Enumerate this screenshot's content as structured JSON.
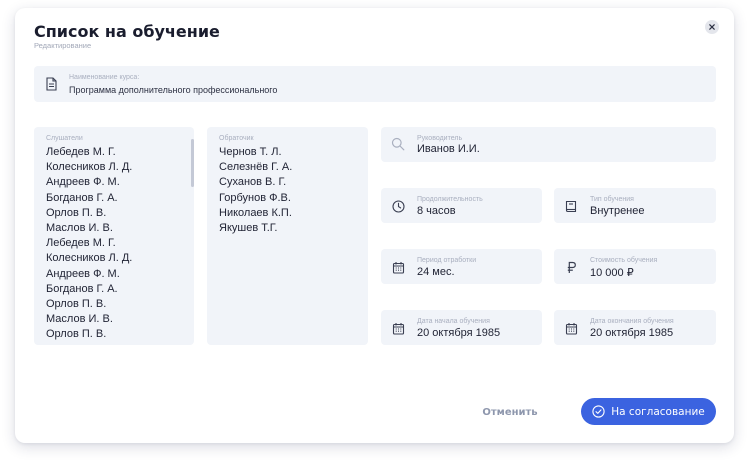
{
  "dialog": {
    "title": "Список на обучение",
    "subtitle": "Редактирование"
  },
  "course": {
    "label": "Наименование курса:",
    "value": "Программа дополнительного профессионального"
  },
  "listeners": {
    "label": "Слушатели",
    "items": [
      "Лебедев М. Г.",
      "Колесников Л. Д.",
      "Андреев Ф. М.",
      "Богданов Г. А.",
      "Орлов П. В.",
      "Маслов И. В.",
      "Лебедев М. Г.",
      "Колесников Л. Д.",
      "Андреев Ф. М.",
      "Богданов Г. А.",
      "Орлов П. В.",
      "Маслов И. В.",
      "Орлов П. В."
    ]
  },
  "trainers": {
    "label": "Обраточик",
    "items": [
      "Чернов Т. Л.",
      "Селезнёв Г. А.",
      "Суханов В. Г.",
      "Горбунов Ф.В.",
      "Николаев К.П.",
      "Якушев Т.Г."
    ]
  },
  "leader": {
    "label": "Руководитель",
    "value": "Иванов И.И."
  },
  "duration": {
    "label": "Продолжительность",
    "value": "8 часов"
  },
  "training_type": {
    "label": "Тип обучения",
    "value": "Внутренее"
  },
  "period": {
    "label": "Период отработки",
    "value": "24 мес."
  },
  "cost": {
    "label": "Стоимость обучения",
    "value": "10 000 ₽"
  },
  "start_date": {
    "label": "Дата начала обучения",
    "value": "20 октября 1985"
  },
  "end_date": {
    "label": "Дата окончания обучения",
    "value": "20 октября 1985"
  },
  "actions": {
    "cancel_label": "Отменить",
    "submit_label": "На согласование"
  },
  "icons": {
    "close": "close-icon",
    "course": "document-icon",
    "leader": "search-icon",
    "duration": "clock-icon",
    "training_type": "book-icon",
    "period": "calendar-icon",
    "cost": "ruble-icon",
    "start_date": "calendar-icon",
    "end_date": "calendar-icon",
    "submit": "check-circle-icon"
  },
  "colors": {
    "accent": "#3b63e0",
    "field_bg": "#f1f4f9",
    "label": "#a9afbf",
    "text": "#1f2233"
  }
}
